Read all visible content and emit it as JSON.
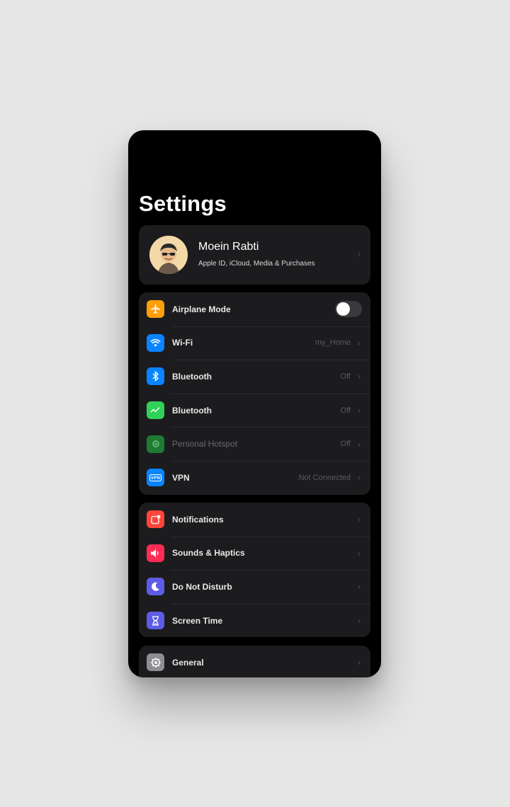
{
  "title": "Settings",
  "profile": {
    "name": "Moein Rabti",
    "subtitle": "Apple ID, iCloud, Media & Purchases"
  },
  "connectivity": [
    {
      "label": "Airplane Mode",
      "value": "",
      "icon": "airplane-icon",
      "color": "#ff9f0a",
      "toggle": false
    },
    {
      "label": "Wi-Fi",
      "value": "my_Home",
      "icon": "wifi-icon",
      "color": "#0a84ff"
    },
    {
      "label": "Bluetooth",
      "value": "Off",
      "icon": "bluetooth-icon",
      "color": "#0a84ff"
    },
    {
      "label": "Bluetooth",
      "value": "Off",
      "icon": "cellular-icon",
      "color": "#30d158"
    },
    {
      "label": "Personal Hotspot",
      "value": "Off",
      "icon": "hotspot-icon",
      "color": "#1f7a34"
    },
    {
      "label": "VPN",
      "value": "Not Connected",
      "icon": "vpn-icon",
      "color": "#0a84ff"
    }
  ],
  "alerts": [
    {
      "label": "Notifications",
      "icon": "notifications-icon",
      "color": "#ff453a"
    },
    {
      "label": "Sounds & Haptics",
      "icon": "speaker-icon",
      "color": "#ff2d55"
    },
    {
      "label": "Do Not Disturb",
      "icon": "moon-icon",
      "color": "#5e5ce6"
    },
    {
      "label": "Screen Time",
      "icon": "hourglass-icon",
      "color": "#5e5ce6"
    }
  ],
  "general": [
    {
      "label": "General",
      "icon": "gear-icon",
      "color": "#8e8e93"
    }
  ]
}
